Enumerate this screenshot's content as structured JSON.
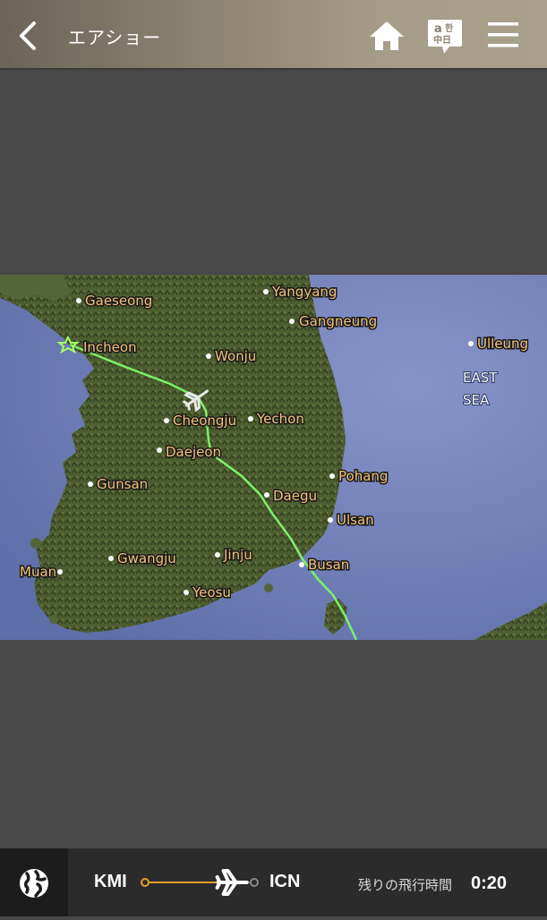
{
  "header": {
    "title": "エアショー",
    "lang_icon_text": {
      "top": "a",
      "top2": "한",
      "bottom": "中日"
    }
  },
  "map": {
    "cities": [
      {
        "key": "gaeseong",
        "name": "Gaeseong"
      },
      {
        "key": "yangyang",
        "name": "Yangyang"
      },
      {
        "key": "gangneung",
        "name": "Gangneung"
      },
      {
        "key": "incheon",
        "name": "Incheon"
      },
      {
        "key": "wonju",
        "name": "Wonju"
      },
      {
        "key": "ulleung",
        "name": "Ulleung"
      },
      {
        "key": "cheongju",
        "name": "Cheongju"
      },
      {
        "key": "yechon",
        "name": "Yechon"
      },
      {
        "key": "daejeon",
        "name": "Daejeon"
      },
      {
        "key": "pohang",
        "name": "Pohang"
      },
      {
        "key": "gunsan",
        "name": "Gunsan"
      },
      {
        "key": "daegu",
        "name": "Daegu"
      },
      {
        "key": "ulsan",
        "name": "Ulsan"
      },
      {
        "key": "gwangju",
        "name": "Gwangju"
      },
      {
        "key": "jinju",
        "name": "Jinju"
      },
      {
        "key": "busan",
        "name": "Busan"
      },
      {
        "key": "muan",
        "name": "Muan"
      },
      {
        "key": "yeosu",
        "name": "Yeosu"
      }
    ],
    "sea_label_line1": "EAST",
    "sea_label_line2": "SEA",
    "route_color": "#7cf06a",
    "land_color": "#4a5a2e",
    "sea_color": "#6e7fb8"
  },
  "footer": {
    "origin": "KMI",
    "destination": "ICN",
    "remaining_label": "残りの飛行時間",
    "remaining_time": "0:20",
    "progress": 0.8,
    "accent_color": "#e0a030"
  }
}
